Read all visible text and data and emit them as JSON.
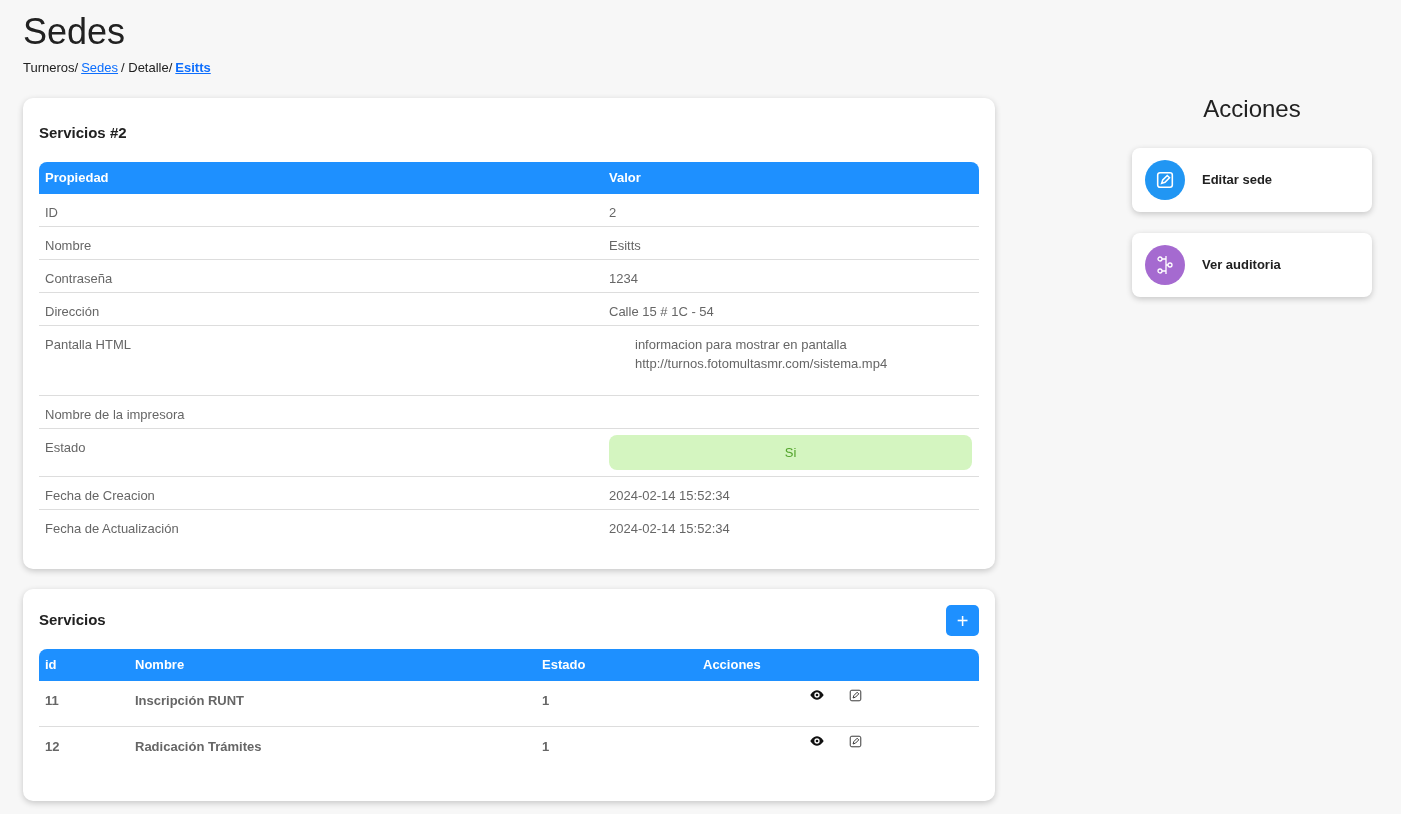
{
  "page_title": "Sedes",
  "breadcrumb": [
    {
      "text": "Turneros/",
      "kind": "plain"
    },
    {
      "text": "Sedes",
      "kind": "link"
    },
    {
      "text": "/ Detalle/",
      "kind": "plain"
    },
    {
      "text": "Esitts",
      "kind": "current"
    }
  ],
  "detail_card": {
    "title": "Servicios #2",
    "columns": [
      "Propiedad",
      "Valor"
    ],
    "rows": [
      {
        "kind": "text",
        "label": "ID",
        "value": "2"
      },
      {
        "kind": "text",
        "label": "Nombre",
        "value": "Esitts"
      },
      {
        "kind": "text",
        "label": "Contraseña",
        "value": "1234"
      },
      {
        "kind": "text",
        "label": "Dirección",
        "value": "Calle 15 # 1C - 54"
      },
      {
        "kind": "html",
        "label": "Pantalla HTML",
        "lines": [
          "informacion para mostrar en pantalla",
          "http://turnos.fotomultasmr.com/sistema.mp4"
        ]
      },
      {
        "kind": "text",
        "label": "Nombre de la impresora"
      },
      {
        "kind": "badge",
        "label": "Estado",
        "value": "Si"
      },
      {
        "kind": "text",
        "label": "Fecha de Creacion",
        "value": "2024-02-14 15:52:34"
      },
      {
        "kind": "text",
        "label": "Fecha de Actualización",
        "value": "2024-02-14 15:52:34"
      }
    ]
  },
  "services_card": {
    "title": "Servicios",
    "add_button": "+",
    "columns": [
      "id",
      "Nombre",
      "Estado",
      "Acciones"
    ],
    "rows": [
      {
        "id": "11",
        "name": "Inscripción RUNT",
        "state": "1"
      },
      {
        "id": "12",
        "name": "Radicación Trámites",
        "state": "1"
      }
    ]
  },
  "actions": {
    "title": "Acciones",
    "items": [
      {
        "label": "Editar sede",
        "kind": "edit",
        "color": "#2196f3"
      },
      {
        "label": "Ver auditoria",
        "kind": "branch",
        "color": "#a56ad0"
      }
    ]
  }
}
